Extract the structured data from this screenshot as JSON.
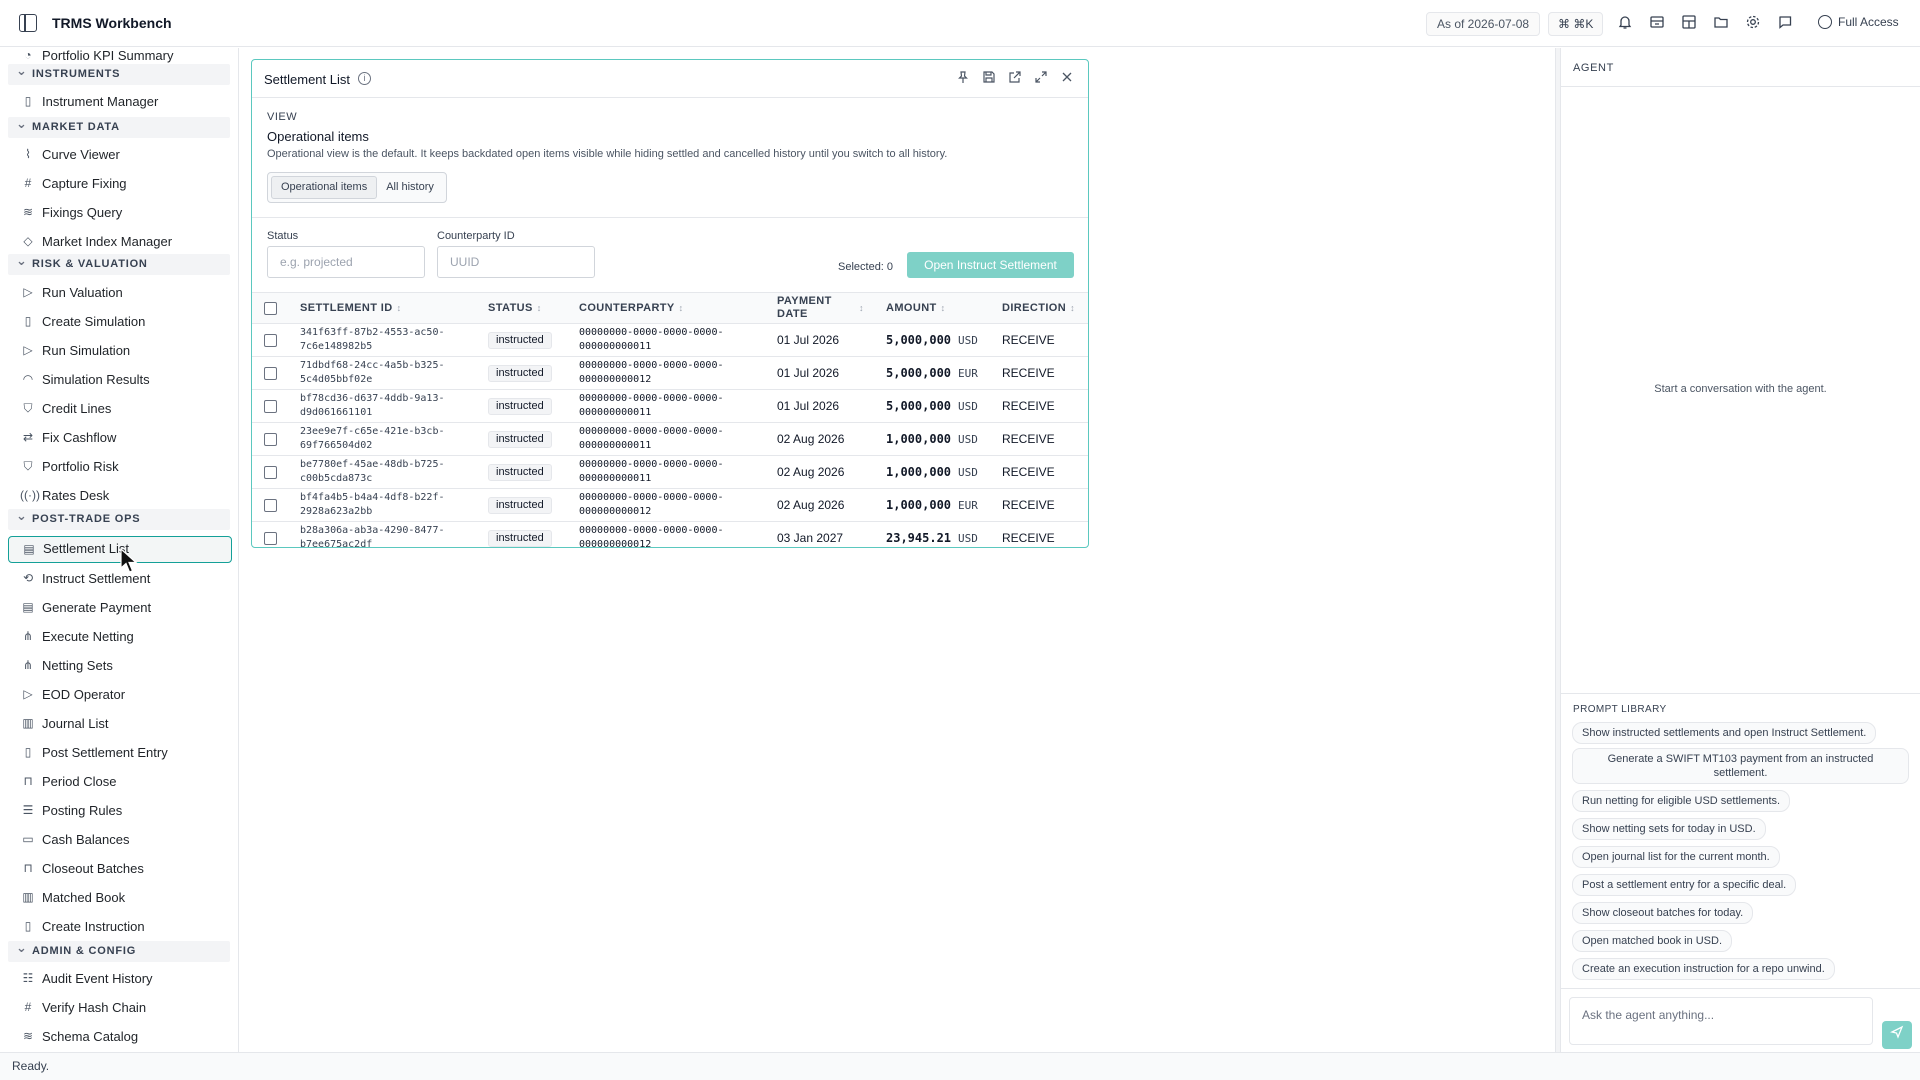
{
  "app": {
    "title": "TRMS Workbench",
    "as_of": "As of 2026-07-08",
    "shortcut": "⌘ ⌘K",
    "access": "Full Access"
  },
  "sidebar": {
    "top_item": "Portfolio KPI Summary",
    "sections": [
      {
        "label": "INSTRUMENTS",
        "items": [
          {
            "label": "Instrument Manager",
            "icon": "document-icon"
          }
        ]
      },
      {
        "label": "MARKET DATA",
        "items": [
          {
            "label": "Curve Viewer",
            "icon": "line-chart-icon"
          },
          {
            "label": "Capture Fixing",
            "icon": "hash-icon"
          },
          {
            "label": "Fixings Query",
            "icon": "database-icon"
          },
          {
            "label": "Market Index Manager",
            "icon": "tag-icon"
          }
        ]
      },
      {
        "label": "RISK & VALUATION",
        "items": [
          {
            "label": "Run Valuation",
            "icon": "play-icon"
          },
          {
            "label": "Create Simulation",
            "icon": "document-icon"
          },
          {
            "label": "Run Simulation",
            "icon": "play-icon"
          },
          {
            "label": "Simulation Results",
            "icon": "gauge-icon"
          },
          {
            "label": "Credit Lines",
            "icon": "shield-icon"
          },
          {
            "label": "Fix Cashflow",
            "icon": "swap-icon"
          },
          {
            "label": "Portfolio Risk",
            "icon": "shield-icon"
          },
          {
            "label": "Rates Desk",
            "icon": "signal-icon"
          }
        ]
      },
      {
        "label": "POST-TRADE OPS",
        "items": [
          {
            "label": "Settlement List",
            "icon": "receipt-icon"
          },
          {
            "label": "Instruct Settlement",
            "icon": "route-icon"
          },
          {
            "label": "Generate Payment",
            "icon": "receipt-icon"
          },
          {
            "label": "Execute Netting",
            "icon": "network-icon"
          },
          {
            "label": "Netting Sets",
            "icon": "network-icon"
          },
          {
            "label": "EOD Operator",
            "icon": "play-icon"
          },
          {
            "label": "Journal List",
            "icon": "book-icon"
          },
          {
            "label": "Post Settlement Entry",
            "icon": "document-icon"
          },
          {
            "label": "Period Close",
            "icon": "lock-icon"
          },
          {
            "label": "Posting Rules",
            "icon": "sliders-icon"
          },
          {
            "label": "Cash Balances",
            "icon": "wallet-icon"
          },
          {
            "label": "Closeout Batches",
            "icon": "lock-icon"
          },
          {
            "label": "Matched Book",
            "icon": "book-icon"
          },
          {
            "label": "Create Instruction",
            "icon": "document-icon"
          }
        ]
      },
      {
        "label": "ADMIN & CONFIG",
        "items": [
          {
            "label": "Audit Event History",
            "icon": "history-icon"
          },
          {
            "label": "Verify Hash Chain",
            "icon": "hash-icon"
          },
          {
            "label": "Schema Catalog",
            "icon": "database-icon"
          }
        ]
      }
    ]
  },
  "panel": {
    "title": "Settlement List",
    "view_label": "VIEW",
    "view_title": "Operational items",
    "view_desc": "Operational view is the default. It keeps backdated open items visible while hiding settled and cancelled history until you switch to all history.",
    "tabs": [
      "Operational items",
      "All history"
    ],
    "filters": {
      "status_label": "Status",
      "status_placeholder": "e.g. projected",
      "cpty_label": "Counterparty ID",
      "cpty_placeholder": "UUID"
    },
    "selected": "Selected: 0",
    "open_button": "Open Instruct Settlement",
    "columns": [
      "SETTLEMENT ID",
      "STATUS",
      "COUNTERPARTY",
      "PAYMENT DATE",
      "AMOUNT",
      "DIRECTION"
    ],
    "rows": [
      {
        "id1": "341f63ff-87b2-4553-ac50-",
        "id2": "7c6e148982b5",
        "status": "instructed",
        "c1": "00000000-0000-0000-0000-",
        "c2": "000000000011",
        "date": "01 Jul 2026",
        "amount": "5,000,000",
        "ccy": "USD",
        "dir": "RECEIVE"
      },
      {
        "id1": "71dbdf68-24cc-4a5b-b325-",
        "id2": "5c4d05bbf02e",
        "status": "instructed",
        "c1": "00000000-0000-0000-0000-",
        "c2": "000000000012",
        "date": "01 Jul 2026",
        "amount": "5,000,000",
        "ccy": "EUR",
        "dir": "RECEIVE"
      },
      {
        "id1": "bf78cd36-d637-4ddb-9a13-",
        "id2": "d9d061661101",
        "status": "instructed",
        "c1": "00000000-0000-0000-0000-",
        "c2": "000000000011",
        "date": "01 Jul 2026",
        "amount": "5,000,000",
        "ccy": "USD",
        "dir": "RECEIVE"
      },
      {
        "id1": "23ee9e7f-c65e-421e-b3cb-",
        "id2": "69f766504d02",
        "status": "instructed",
        "c1": "00000000-0000-0000-0000-",
        "c2": "000000000011",
        "date": "02 Aug 2026",
        "amount": "1,000,000",
        "ccy": "USD",
        "dir": "RECEIVE"
      },
      {
        "id1": "be7780ef-45ae-48db-b725-",
        "id2": "c00b5cda873c",
        "status": "instructed",
        "c1": "00000000-0000-0000-0000-",
        "c2": "000000000011",
        "date": "02 Aug 2026",
        "amount": "1,000,000",
        "ccy": "USD",
        "dir": "RECEIVE"
      },
      {
        "id1": "bf4fa4b5-b4a4-4df8-b22f-",
        "id2": "2928a623a2bb",
        "status": "instructed",
        "c1": "00000000-0000-0000-0000-",
        "c2": "000000000012",
        "date": "02 Aug 2026",
        "amount": "1,000,000",
        "ccy": "EUR",
        "dir": "RECEIVE"
      },
      {
        "id1": "b28a306a-ab3a-4290-8477-",
        "id2": "b7ee675ac2df",
        "status": "instructed",
        "c1": "00000000-0000-0000-0000-",
        "c2": "000000000012",
        "date": "03 Jan 2027",
        "amount": "23,945.21",
        "ccy": "USD",
        "dir": "RECEIVE"
      }
    ]
  },
  "agent": {
    "title": "AGENT",
    "empty": "Start a conversation with the agent.",
    "prompt_title": "PROMPT LIBRARY",
    "prompts": [
      "Show instructed settlements and open Instruct Settlement.",
      "Generate a SWIFT MT103 payment from an instructed settlement.",
      "Run netting for eligible USD settlements.",
      "Show netting sets for today in USD.",
      "Open journal list for the current month.",
      "Post a settlement entry for a specific deal.",
      "Show closeout batches for today.",
      "Open matched book in USD.",
      "Create an execution instruction for a repo unwind."
    ],
    "input_placeholder": "Ask the agent anything..."
  },
  "status": "Ready."
}
